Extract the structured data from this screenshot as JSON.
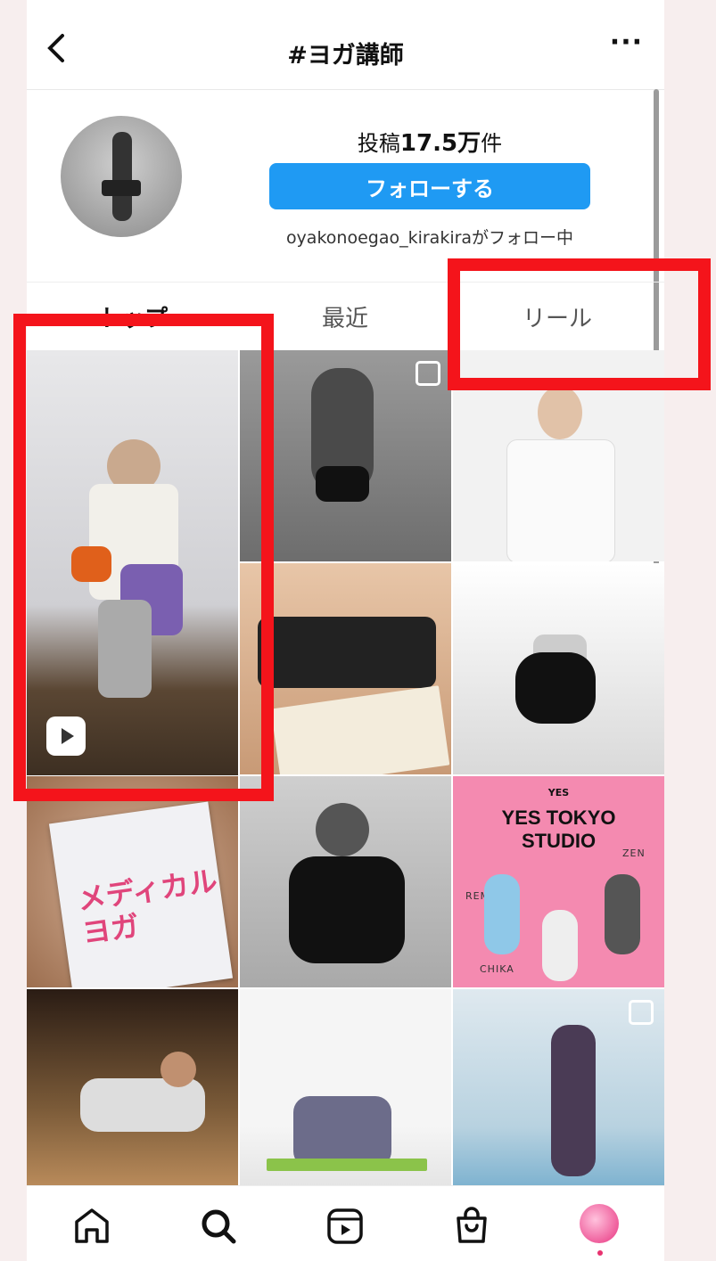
{
  "header": {
    "title": "#ヨガ講師"
  },
  "profile": {
    "posts_label": "投稿",
    "posts_count": "17.5万",
    "posts_unit": "件",
    "follow_button": "フォローする",
    "followed_by": "oyakonoegao_kirakiraがフォロー中"
  },
  "tabs": [
    {
      "label": "トップ"
    },
    {
      "label": "最近"
    },
    {
      "label": "リール"
    }
  ],
  "grid": {
    "book_title": "メディカル\nヨガ",
    "yes_small": "YES",
    "yes_title": "YES TOKYO\nSTUDIO",
    "yes_names": [
      "REMI",
      "ZEN",
      "CHIKA"
    ]
  },
  "colors": {
    "accent": "#1f9af3",
    "highlight": "#f4141b",
    "yes_bg": "#f48ab0"
  },
  "icons": {
    "back": "chevron-left-icon",
    "more": "ellipsis-icon",
    "nav": [
      "home-icon",
      "search-icon",
      "reels-icon",
      "shop-icon",
      "profile-avatar"
    ]
  }
}
